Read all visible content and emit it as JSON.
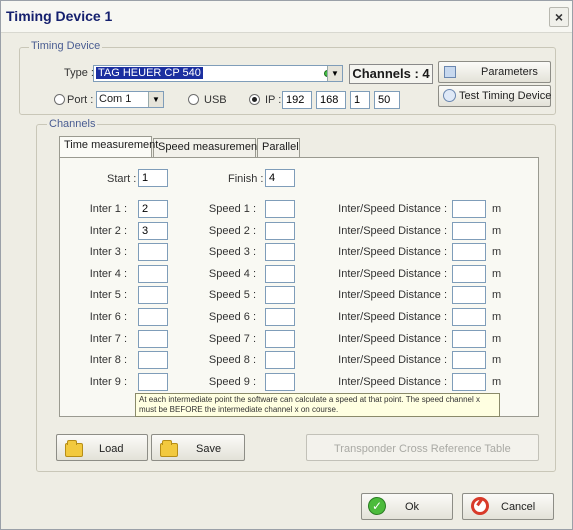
{
  "window": {
    "title": "Timing Device 1",
    "close_glyph": "×"
  },
  "timing_device": {
    "legend": "Timing Device",
    "type_label": "Type :",
    "type_value": "TAG HEUER CP 540",
    "channels_badge": "Channels : 4",
    "parameters_button": "Parameters",
    "test_button": "Test Timing Device",
    "port_label": "Port :",
    "port_value": "Com 1",
    "usb_label": "USB",
    "ip_label": "IP :",
    "ip": [
      "192",
      "168",
      "1",
      "50"
    ],
    "selected_connection": "IP"
  },
  "channels": {
    "legend": "Channels",
    "tabs": [
      "Time measurement",
      "Speed measurement",
      "Parallel"
    ],
    "active_tab": "Time measurement",
    "start_label": "Start :",
    "start_value": "1",
    "finish_label": "Finish :",
    "finish_value": "4",
    "rows": [
      {
        "inter_label": "Inter 1 :",
        "inter_value": "2",
        "speed_label": "Speed 1 :",
        "speed_value": "",
        "distance_label": "Inter/Speed Distance :",
        "distance_value": "",
        "unit": "m"
      },
      {
        "inter_label": "Inter 2 :",
        "inter_value": "3",
        "speed_label": "Speed 2 :",
        "speed_value": "",
        "distance_label": "Inter/Speed Distance :",
        "distance_value": "",
        "unit": "m"
      },
      {
        "inter_label": "Inter 3 :",
        "inter_value": "",
        "speed_label": "Speed 3 :",
        "speed_value": "",
        "distance_label": "Inter/Speed Distance :",
        "distance_value": "",
        "unit": "m"
      },
      {
        "inter_label": "Inter 4 :",
        "inter_value": "",
        "speed_label": "Speed 4 :",
        "speed_value": "",
        "distance_label": "Inter/Speed Distance :",
        "distance_value": "",
        "unit": "m"
      },
      {
        "inter_label": "Inter 5 :",
        "inter_value": "",
        "speed_label": "Speed 5 :",
        "speed_value": "",
        "distance_label": "Inter/Speed Distance :",
        "distance_value": "",
        "unit": "m"
      },
      {
        "inter_label": "Inter 6 :",
        "inter_value": "",
        "speed_label": "Speed 6 :",
        "speed_value": "",
        "distance_label": "Inter/Speed Distance :",
        "distance_value": "",
        "unit": "m"
      },
      {
        "inter_label": "Inter 7 :",
        "inter_value": "",
        "speed_label": "Speed 7 :",
        "speed_value": "",
        "distance_label": "Inter/Speed Distance :",
        "distance_value": "",
        "unit": "m"
      },
      {
        "inter_label": "Inter 8 :",
        "inter_value": "",
        "speed_label": "Speed 8 :",
        "speed_value": "",
        "distance_label": "Inter/Speed Distance :",
        "distance_value": "",
        "unit": "m"
      },
      {
        "inter_label": "Inter 9 :",
        "inter_value": "",
        "speed_label": "Speed 9 :",
        "speed_value": "",
        "distance_label": "Inter/Speed Distance :",
        "distance_value": "",
        "unit": "m"
      }
    ],
    "tooltip": "At each intermediate point the software can calculate a speed at that point. The speed channel x must be BEFORE the intermediate channel x on course."
  },
  "actions": {
    "load_button": "Load",
    "save_button": "Save",
    "transponder_button": "Transponder Cross Reference Table",
    "ok_button": "Ok",
    "cancel_button": "Cancel"
  },
  "colors": {
    "title_text": "#15206e",
    "selection": "#1b2fa0",
    "legend_text": "#4a5d92"
  }
}
